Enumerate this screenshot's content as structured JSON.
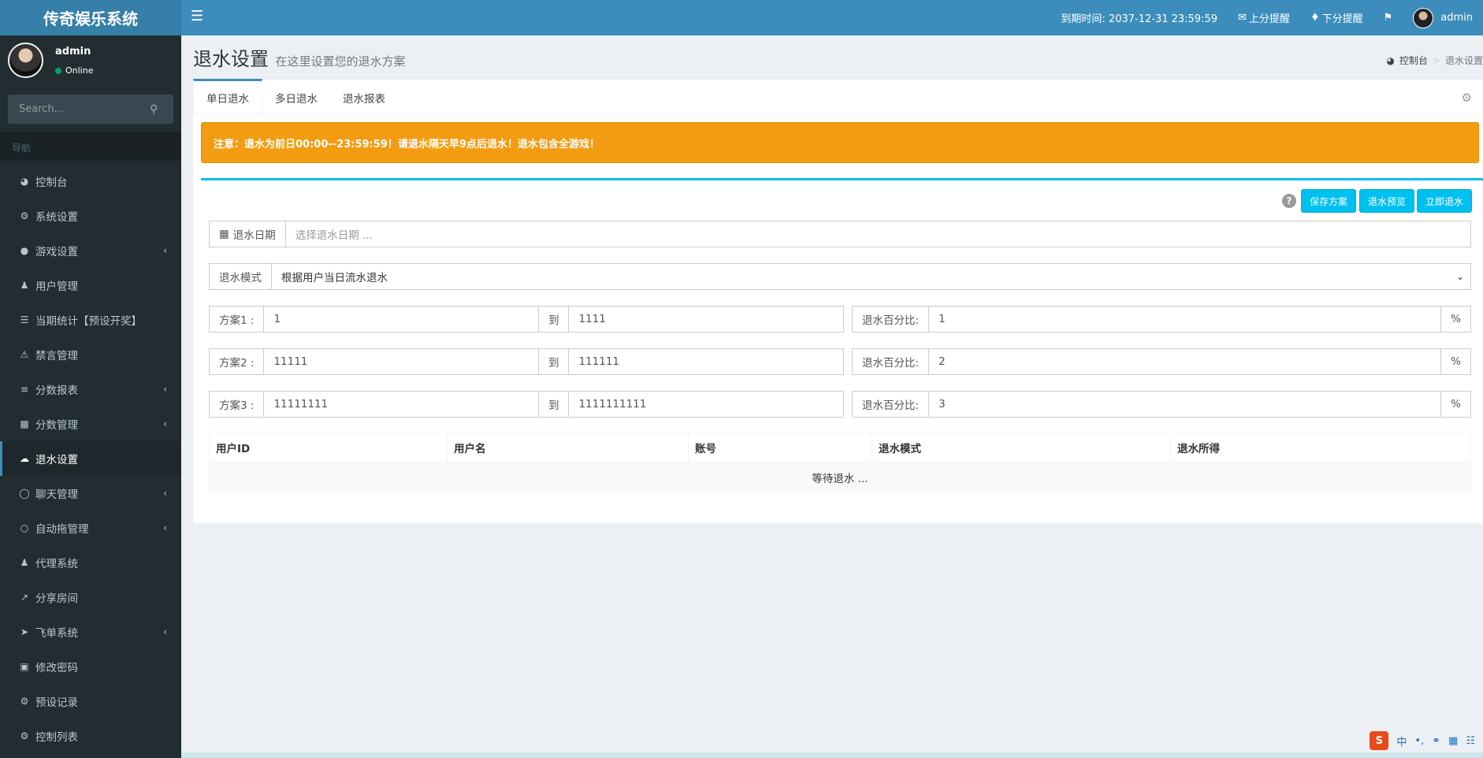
{
  "header": {
    "logo": "传奇娱乐系统",
    "menu_icon": "bars-icon",
    "expiry": "到期时间: 2037-12-31 23:59:59",
    "up_alert": "上分提醒",
    "down_alert": "下分提醒",
    "user": "admin"
  },
  "sidebar": {
    "username": "admin",
    "status": "Online",
    "search_placeholder": "Search...",
    "nav_header": "导航",
    "items": [
      {
        "label": "控制台",
        "icon": "dashboard-icon",
        "sub": false
      },
      {
        "label": "系统设置",
        "icon": "cogs-icon",
        "sub": false
      },
      {
        "label": "游戏设置",
        "icon": "gamepad-icon",
        "sub": true
      },
      {
        "label": "用户管理",
        "icon": "users-icon",
        "sub": false
      },
      {
        "label": "当期统计【预设开奖】",
        "icon": "list-icon",
        "sub": false
      },
      {
        "label": "禁言管理",
        "icon": "warning-icon",
        "sub": false
      },
      {
        "label": "分数报表",
        "icon": "list-ol-icon",
        "sub": true
      },
      {
        "label": "分数管理",
        "icon": "database-icon",
        "sub": true
      },
      {
        "label": "退水设置",
        "icon": "cloud-download-icon",
        "sub": false,
        "active": true
      },
      {
        "label": "聊天管理",
        "icon": "comments-icon",
        "sub": true
      },
      {
        "label": "自动拖管理",
        "icon": "comment-icon",
        "sub": true
      },
      {
        "label": "代理系统",
        "icon": "user-plus-icon",
        "sub": false
      },
      {
        "label": "分享房间",
        "icon": "share-icon",
        "sub": false
      },
      {
        "label": "飞单系统",
        "icon": "paper-plane-icon",
        "sub": true
      },
      {
        "label": "修改密码",
        "icon": "cart-icon",
        "sub": false
      },
      {
        "label": "预设记录",
        "icon": "gear-icon",
        "sub": false
      },
      {
        "label": "控制列表",
        "icon": "gear-icon",
        "sub": false
      }
    ]
  },
  "page": {
    "title": "退水设置",
    "subtitle": "在这里设置您的退水方案",
    "breadcrumb_home": "控制台",
    "breadcrumb_current": "退水设置"
  },
  "tabs": [
    "单日退水",
    "多日退水",
    "退水报表"
  ],
  "alert": "注意：退水为前日00:00--23:59:59！请退水隔天早9点后退水！退水包含全游戏！",
  "buttons": {
    "save": "保存方案",
    "preview": "退水预览",
    "now": "立即退水"
  },
  "form": {
    "date_label": "退水日期",
    "date_placeholder": "选择退水日期 ...",
    "mode_label": "退水模式",
    "mode_value": "根据用户当日流水退水",
    "to_label": "到",
    "percent_label": "退水百分比:",
    "percent_unit": "%",
    "plans": [
      {
        "label": "方案1 :",
        "from": "1",
        "to": "1111",
        "percent": "1"
      },
      {
        "label": "方案2 :",
        "from": "11111",
        "to": "111111",
        "percent": "2"
      },
      {
        "label": "方案3 :",
        "from": "11111111",
        "to": "1111111111",
        "percent": "3"
      }
    ]
  },
  "table": {
    "headers": [
      "用户ID",
      "用户名",
      "账号",
      "退水模式",
      "退水所得"
    ],
    "empty": "等待退水 ..."
  },
  "ime": {
    "lang": "中"
  }
}
